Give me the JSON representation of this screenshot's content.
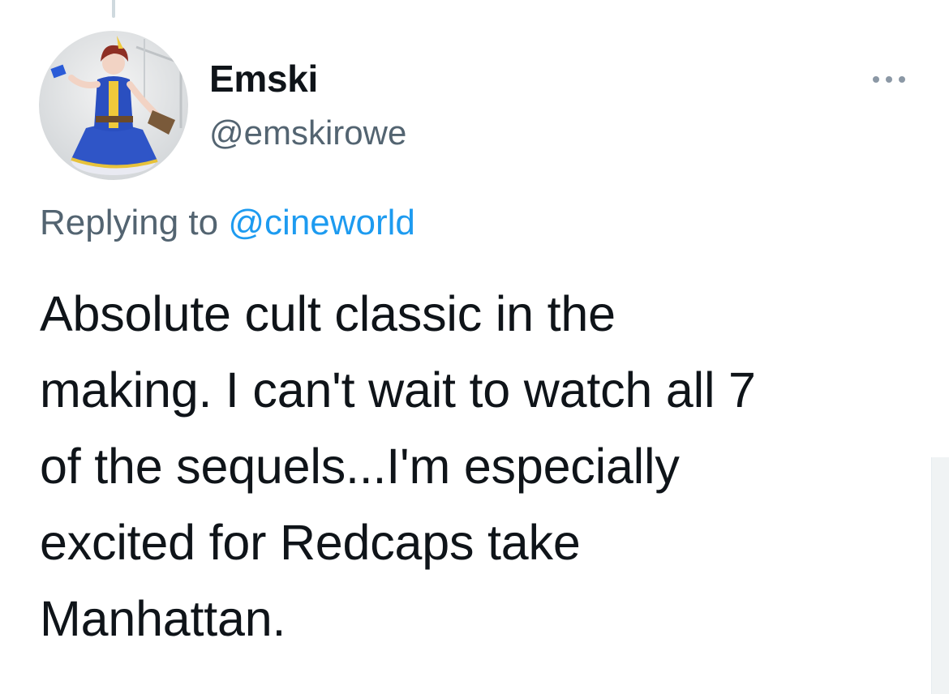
{
  "tweet": {
    "author": {
      "display_name": "Emski",
      "handle": "@emskirowe",
      "avatar_icon": "profile-photo-avatar"
    },
    "reply_context": {
      "prefix": "Replying to",
      "mention": "@cineworld"
    },
    "body_lines": [
      "Absolute cult classic in the",
      "making. I can't wait to watch all 7",
      "of the sequels...I'm especially",
      "excited for Redcaps take",
      "Manhattan."
    ],
    "more_icon": "ellipsis-icon"
  },
  "colors": {
    "text_primary": "#0f1419",
    "text_secondary": "#536471",
    "link": "#1d9bf0",
    "thread_line": "#cfd9de"
  }
}
